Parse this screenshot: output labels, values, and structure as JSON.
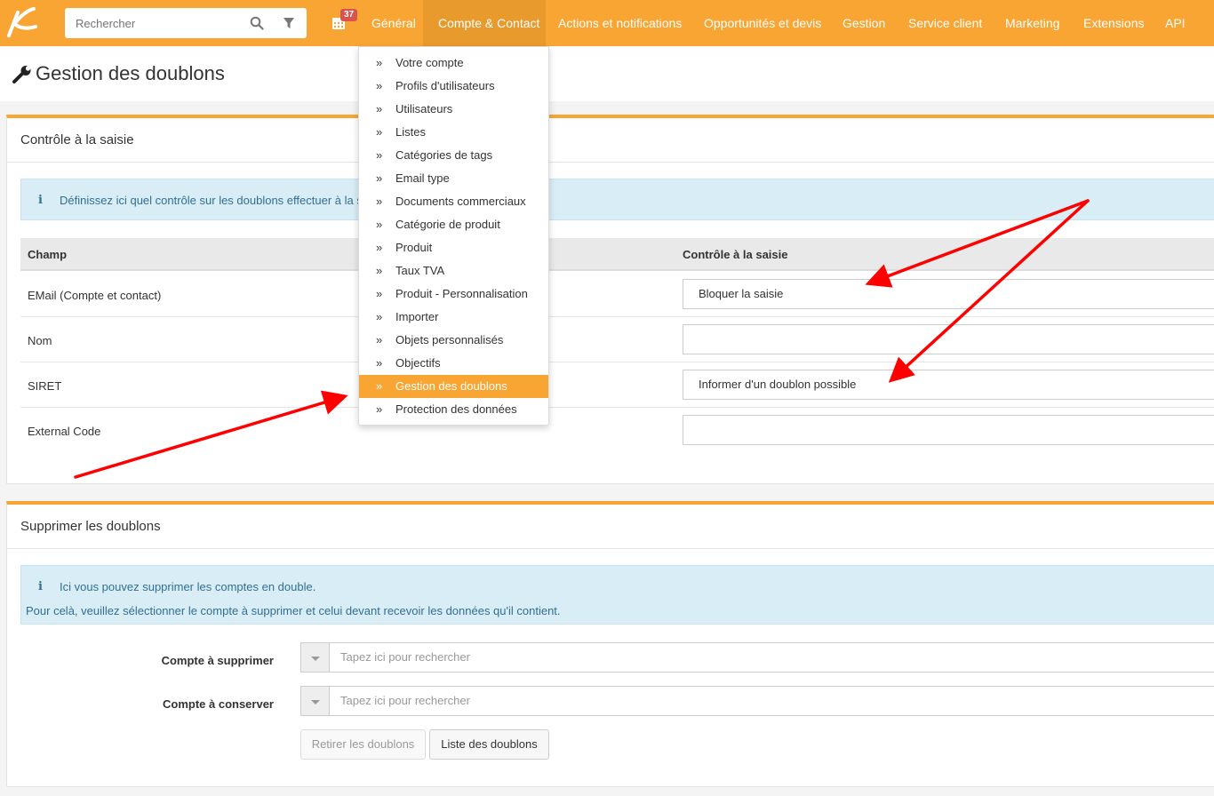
{
  "search": {
    "placeholder": "Rechercher"
  },
  "calendar": {
    "badge": "37"
  },
  "nav": {
    "items": [
      {
        "label": "Général"
      },
      {
        "label": "Compte & Contact"
      },
      {
        "label": "Actions et notifications"
      },
      {
        "label": "Opportunités et devis"
      },
      {
        "label": "Gestion"
      },
      {
        "label": "Service client"
      },
      {
        "label": "Marketing"
      },
      {
        "label": "Extensions"
      },
      {
        "label": "API"
      }
    ]
  },
  "dropdown": {
    "items": [
      {
        "label": "Votre compte"
      },
      {
        "label": "Profils d'utilisateurs"
      },
      {
        "label": "Utilisateurs"
      },
      {
        "label": "Listes"
      },
      {
        "label": "Catégories de tags"
      },
      {
        "label": "Email type"
      },
      {
        "label": "Documents commerciaux"
      },
      {
        "label": "Catégorie de produit"
      },
      {
        "label": "Produit"
      },
      {
        "label": "Taux TVA"
      },
      {
        "label": "Produit - Personnalisation"
      },
      {
        "label": "Importer"
      },
      {
        "label": "Objets personnalisés"
      },
      {
        "label": "Objectifs"
      },
      {
        "label": "Gestion des doublons"
      },
      {
        "label": "Protection des données"
      }
    ],
    "active": "Gestion des doublons"
  },
  "page": {
    "title": "Gestion des doublons"
  },
  "controle": {
    "title": "Contrôle à la saisie",
    "info": "Définissez ici quel contrôle sur les doublons effectuer à la s",
    "col_champ": "Champ",
    "col_controle": "Contrôle à la saisie",
    "rows": [
      {
        "label": "EMail (Compte et contact)",
        "value": "Bloquer la saisie"
      },
      {
        "label": "Nom",
        "value": ""
      },
      {
        "label": "SIRET",
        "value": "Informer d'un doublon possible"
      },
      {
        "label": "External Code",
        "value": ""
      }
    ]
  },
  "supprimer": {
    "title": "Supprimer les doublons",
    "info_line1": "Ici vous pouvez supprimer les comptes en double.",
    "info_line2": "Pour celà, veuillez sélectionner le compte à supprimer et celui devant recevoir les données qu'il contient.",
    "compte_supprimer_label": "Compte à supprimer",
    "compte_conserver_label": "Compte à conserver",
    "search_placeholder": "Tapez ici pour rechercher",
    "btn_retirer": "Retirer les doublons",
    "btn_liste": "Liste des doublons"
  },
  "colors": {
    "brand": "#f9a533",
    "brand_dark": "#e99a2c",
    "info_bg": "#d9edf7",
    "info_text": "#31708f",
    "badge": "#d9534f",
    "annotation_arrow": "#ff0000"
  }
}
